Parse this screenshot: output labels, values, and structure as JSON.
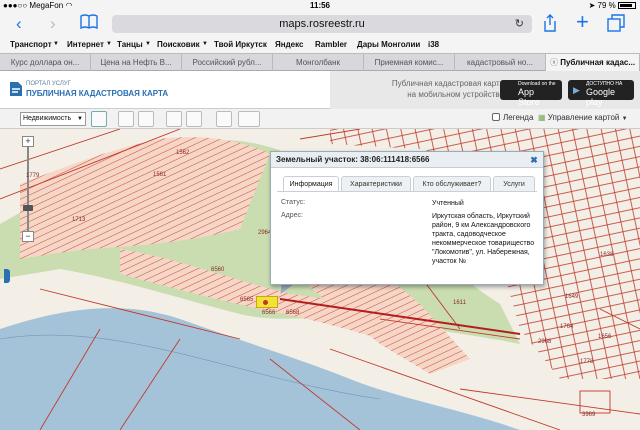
{
  "status_bar": {
    "carrier": "MegaFon",
    "time": "11:56",
    "battery": "79 %"
  },
  "browser": {
    "url": "maps.rosreestr.ru"
  },
  "bookmarks": [
    "Транспорт",
    "Интернет",
    "Танцы",
    "Поисковик",
    "Твой Иркутск",
    "Яндекс",
    "Rambler",
    "Дары Монголии",
    "i38"
  ],
  "tabs": [
    "Курс доллара он...",
    "Цена на Нефть В...",
    "Российский рубл...",
    "Монголбанк",
    "Приемная комис...",
    "кадастровый но...",
    "Публичная кадас..."
  ],
  "header": {
    "logo_line1": "ПОРТАЛ УСЛУГ",
    "logo_line2": "ПУБЛИЧНАЯ КАДАСТРОВАЯ КАРТА",
    "promo_line1": "Публичная кадастровая карта",
    "promo_line2": "на мобильном устройстве",
    "appstore_small": "Download on the",
    "appstore_big": "App Store",
    "googleplay_small": "ДОСТУПНО НА",
    "googleplay_big": "Google play"
  },
  "toolbar": {
    "select_value": "Недвижимость",
    "legend_label": "Легенда",
    "map_control_label": "Управление картой"
  },
  "popup": {
    "title": "Земельный участок: 38:06:111418:6566",
    "tabs": [
      "Информация",
      "Характеристики",
      "Кто обслуживает?",
      "Услуги"
    ],
    "status_label": "Статус:",
    "status_value": "Учтенный",
    "address_label": "Адрес:",
    "address_value": "Иркутская область, Иркутский район, 9 км Александровского тракта, садоводческое некоммерческое товарищество \"Локомотив\", ул. Набережная, участок №"
  },
  "map_labels": [
    "1561",
    "1562",
    "1779",
    "1713",
    "6560",
    "6565",
    "6568",
    "6566",
    "1764",
    "2964",
    "1611",
    "1638",
    "1649",
    "1764",
    "1656",
    "2968",
    "1778",
    "3969"
  ],
  "colors": {
    "parcel_line": "#c0392b",
    "parcel_fill": "#f6d6c6",
    "vegetation": "#c9ddb0",
    "water": "#a5c3d8",
    "selected": "#f5e236",
    "accent": "#2a6fb0"
  }
}
